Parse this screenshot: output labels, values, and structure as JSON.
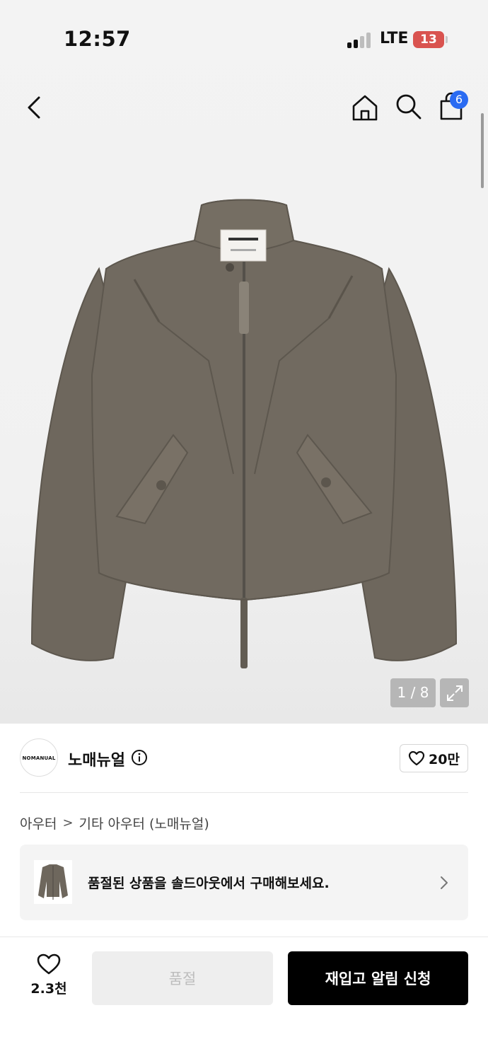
{
  "status_bar": {
    "time": "12:57",
    "network": "LTE",
    "battery": "13"
  },
  "header": {
    "back_icon": "chevron-left-icon",
    "home_icon": "home-icon",
    "search_icon": "search-icon",
    "cart_icon": "shopping-bag-icon",
    "cart_count": "6"
  },
  "gallery": {
    "image_subject": "olive brown zip-up jacket",
    "counter": "1 / 8",
    "expand_icon": "expand-icon"
  },
  "brand": {
    "logo_text": "NOMANUAL",
    "name": "노매뉴얼",
    "info_icon": "info-icon",
    "likes": "20만"
  },
  "breadcrumb": {
    "items": [
      "아우터",
      "기타 아우터 (노매뉴얼)"
    ],
    "separator": ">"
  },
  "soldout_banner": {
    "text": "품절된 상품을 솔드아웃에서 구매해보세요.",
    "chevron_icon": "chevron-right-icon"
  },
  "bottom_bar": {
    "wish_icon": "heart-icon",
    "wish_count": "2.3천",
    "soldout_label": "품절",
    "restock_label": "재입고 알림 신청"
  },
  "colors": {
    "accent_badge": "#2a6bf2",
    "battery_low": "#d9534f",
    "jacket": "#6e675d",
    "primary_button": "#000000"
  }
}
